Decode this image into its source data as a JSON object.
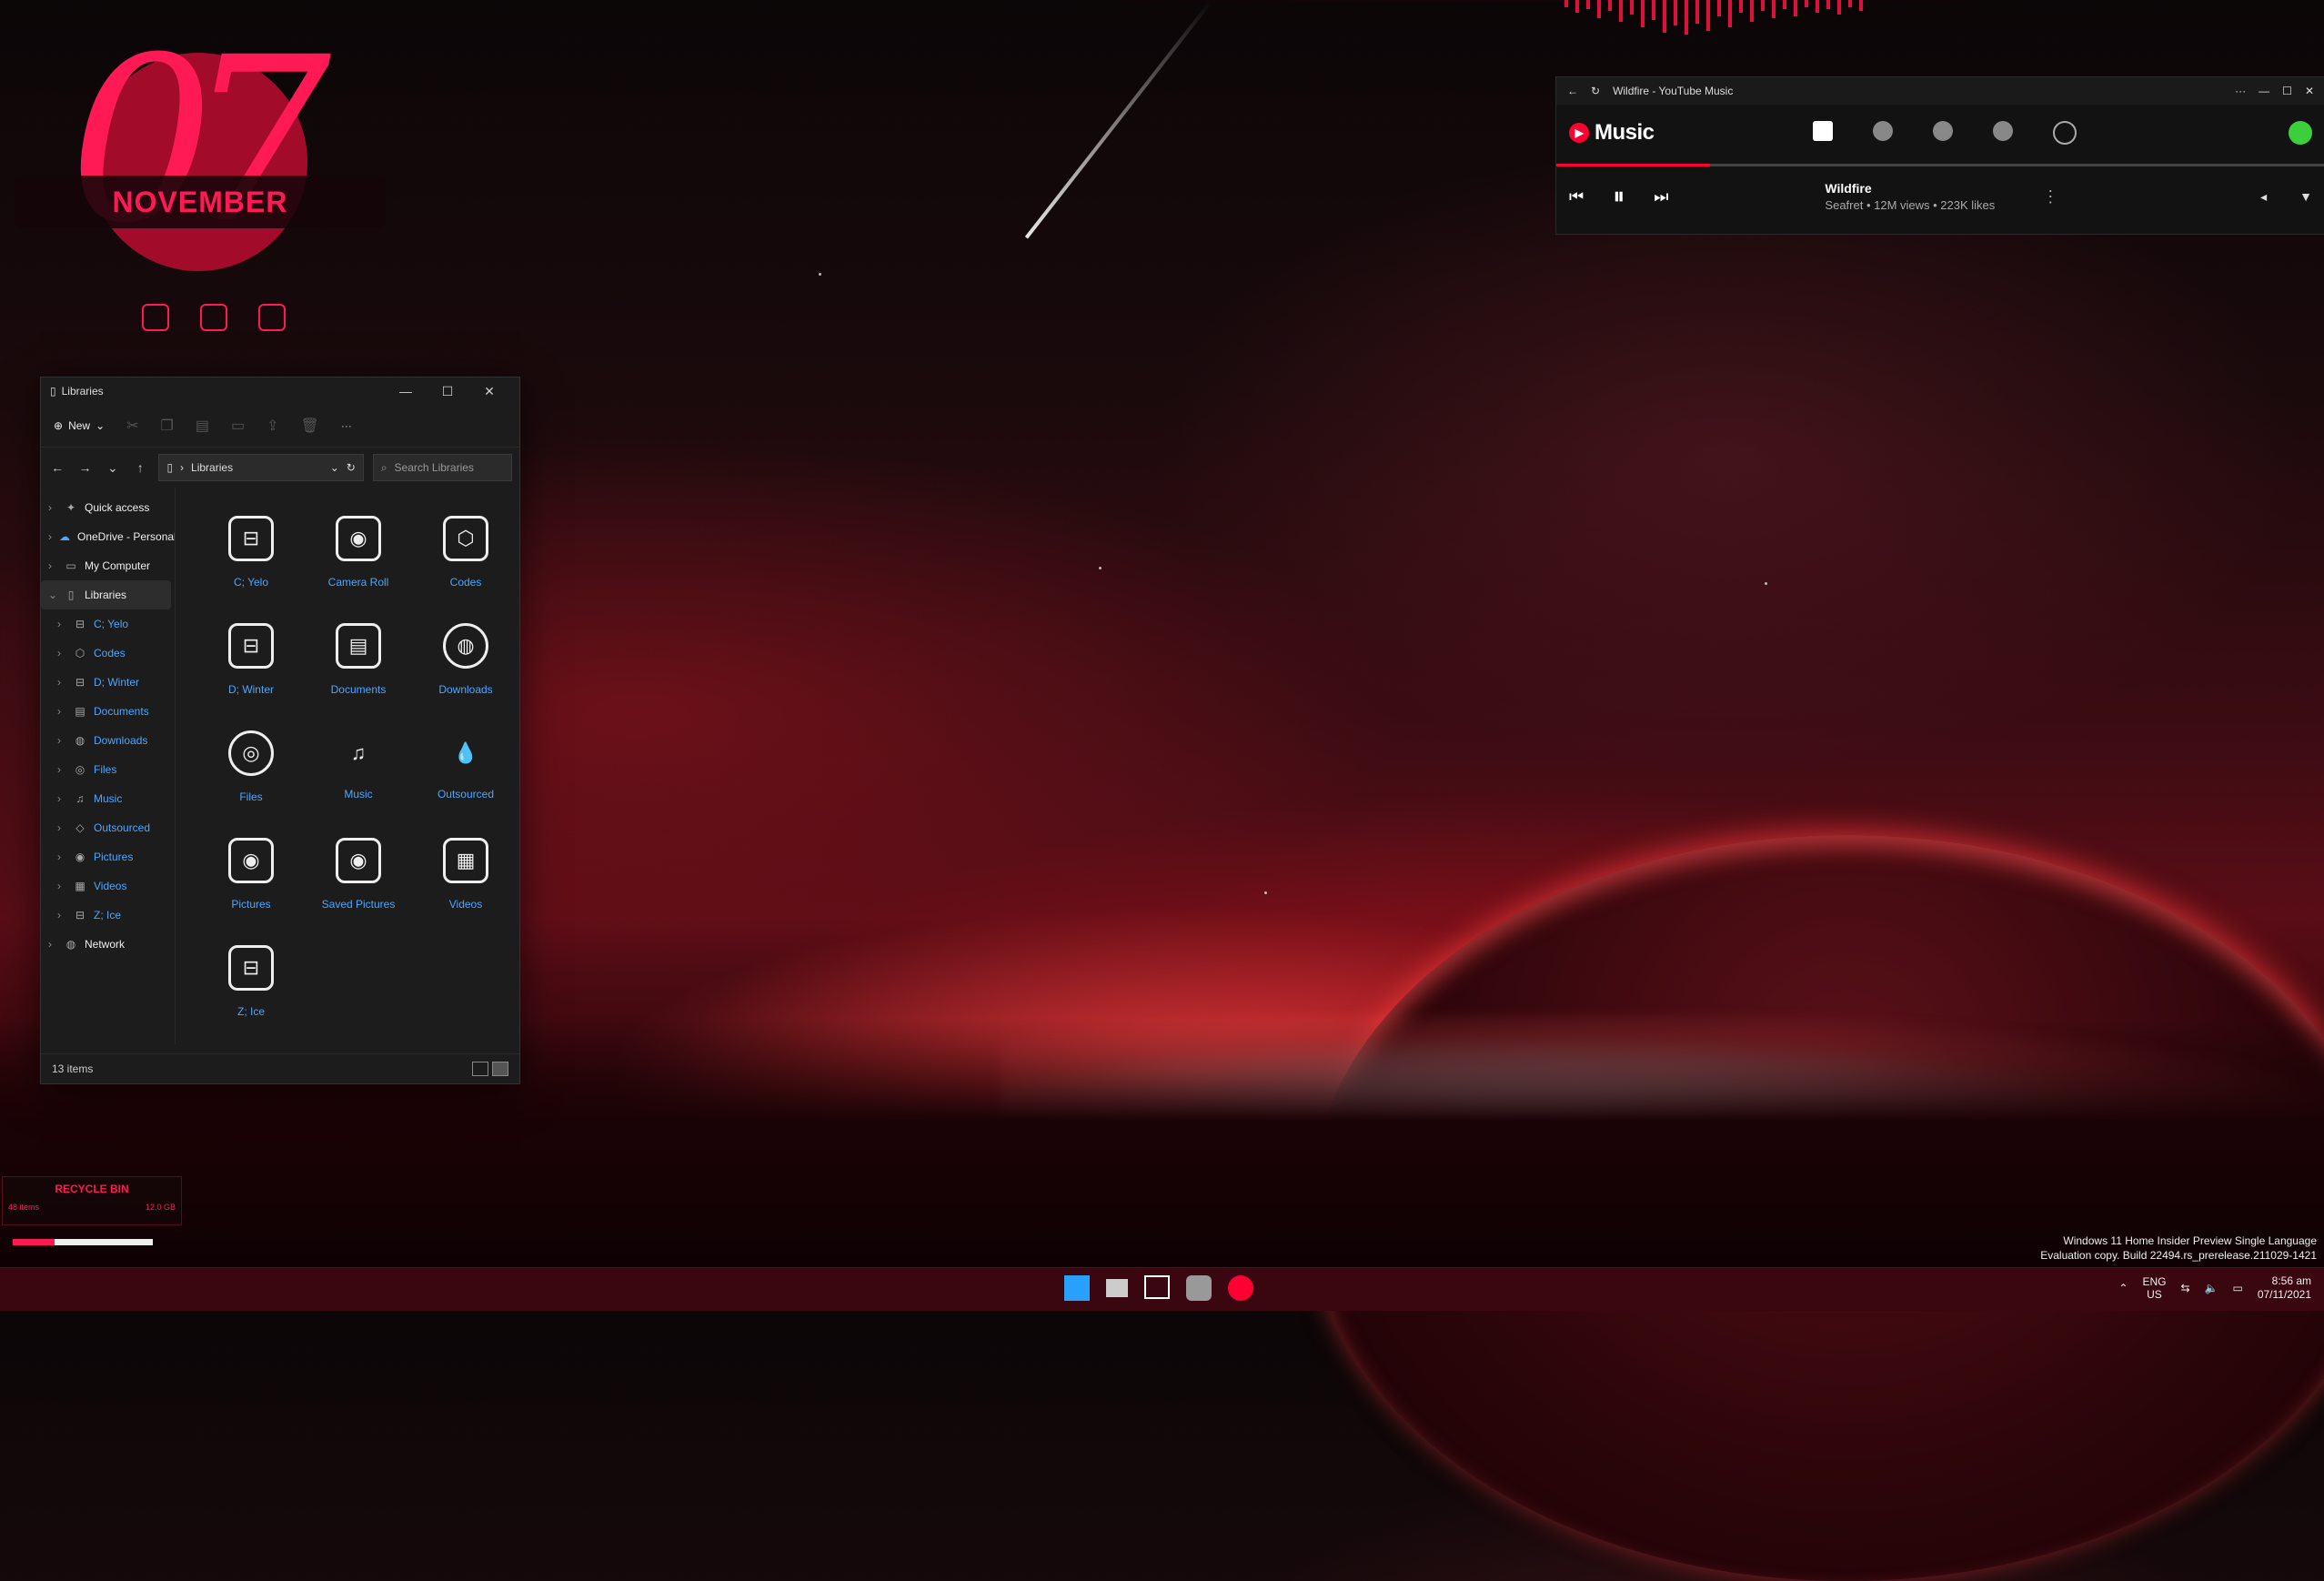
{
  "date_widget": {
    "day": "07",
    "month": "NOVEMBER"
  },
  "explorer": {
    "title": "Libraries",
    "toolbar": {
      "new_label": "New",
      "more": "···"
    },
    "address": {
      "path": "Libraries",
      "search_placeholder": "Search Libraries"
    },
    "sidebar": {
      "top": [
        "Quick access",
        "OneDrive - Personal",
        "My Computer"
      ],
      "libraries_label": "Libraries",
      "children": [
        "C; Yelo",
        "Codes",
        "D; Winter",
        "Documents",
        "Downloads",
        "Files",
        "Music",
        "Outsourced",
        "Pictures",
        "Videos",
        "Z; Ice"
      ],
      "network": "Network"
    },
    "items": [
      "C; Yelo",
      "Camera Roll",
      "Codes",
      "D; Winter",
      "Documents",
      "Downloads",
      "Files",
      "Music",
      "Outsourced",
      "Pictures",
      "Saved Pictures",
      "Videos",
      "Z; Ice"
    ],
    "status": "13 items"
  },
  "recycle_bin": {
    "title": "RECYCLE BIN",
    "items": "48 items",
    "size": "12.0 GB",
    "fill_fraction": 0.3
  },
  "ytmusic": {
    "window_title": "Wildfire - YouTube Music",
    "logo": "Music",
    "track": {
      "title": "Wildfire",
      "subtitle": "Seafret • 12M views • 223K likes"
    },
    "progress_fraction": 0.2
  },
  "watermark": {
    "line1": "Windows 11 Home Insider Preview Single Language",
    "line2": "Evaluation copy. Build 22494.rs_prerelease.211029-1421"
  },
  "taskbar": {
    "lang": "ENG",
    "region": "US",
    "time": "8:56 am",
    "date": "07/11/2021"
  },
  "colors": {
    "accent": "#ff1a55",
    "link": "#4da6ff",
    "yt_red": "#ff0033"
  }
}
